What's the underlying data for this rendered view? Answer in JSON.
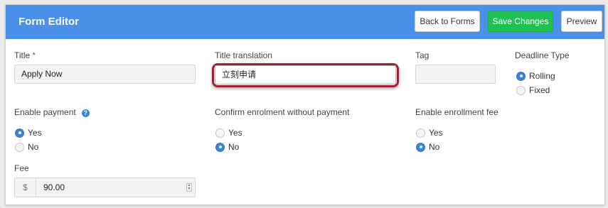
{
  "header": {
    "title": "Form Editor",
    "back_label": "Back to Forms",
    "save_label": "Save Changes",
    "preview_label": "Preview"
  },
  "fields": {
    "title": {
      "label": "Title",
      "required_mark": "*",
      "value": "Apply Now"
    },
    "title_translation": {
      "label": "Title translation",
      "value": "立刻申请"
    },
    "tag": {
      "label": "Tag",
      "value": ""
    },
    "deadline_type": {
      "label": "Deadline Type",
      "options": [
        "Rolling",
        "Fixed"
      ],
      "selected": "Rolling"
    },
    "enable_payment": {
      "label": "Enable payment",
      "help_icon": "question-circle-icon",
      "help_glyph": "?",
      "options": [
        "Yes",
        "No"
      ],
      "selected": "Yes"
    },
    "confirm_enrolment": {
      "label": "Confirm enrolment without payment",
      "options": [
        "Yes",
        "No"
      ],
      "selected": "No"
    },
    "enable_enrollment_fee": {
      "label": "Enable enrollment fee",
      "options": [
        "Yes",
        "No"
      ],
      "selected": "No"
    },
    "fee": {
      "label": "Fee",
      "currency_symbol": "$",
      "value": "90.00"
    }
  },
  "colors": {
    "header_bg": "#4a8fe8",
    "save_button": "#1fc154",
    "radio_checked": "#3b82e0",
    "highlight_ring": "#9e2235",
    "required": "#e03b3b"
  }
}
